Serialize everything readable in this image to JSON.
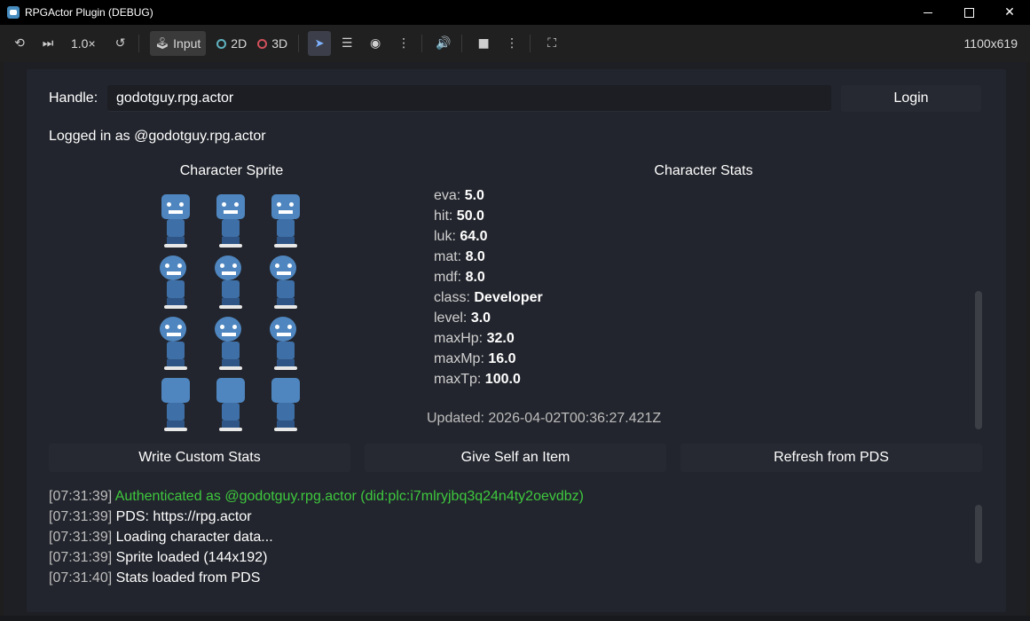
{
  "window": {
    "title": "RPGActor Plugin (DEBUG)"
  },
  "toolbar": {
    "speed": "1.0×",
    "input_label": "Input",
    "mode_2d": "2D",
    "mode_3d": "3D",
    "resolution": "1100x619"
  },
  "handle": {
    "label": "Handle:",
    "value": "godotguy.rpg.actor",
    "login_label": "Login"
  },
  "status": "Logged in as @godotguy.rpg.actor",
  "sprite_title": "Character Sprite",
  "stats_title": "Character Stats",
  "stats": [
    {
      "key": "eva:",
      "value": "5.0"
    },
    {
      "key": "hit:",
      "value": "50.0"
    },
    {
      "key": "luk:",
      "value": "64.0"
    },
    {
      "key": "mat:",
      "value": "8.0"
    },
    {
      "key": "mdf:",
      "value": "8.0"
    },
    {
      "key": "class:",
      "value": "Developer"
    },
    {
      "key": "level:",
      "value": "3.0"
    },
    {
      "key": "maxHp:",
      "value": "32.0"
    },
    {
      "key": "maxMp:",
      "value": "16.0"
    },
    {
      "key": "maxTp:",
      "value": "100.0"
    }
  ],
  "updated": "Updated: 2026-04-02T00:36:27.421Z",
  "actions": {
    "write_stats": "Write Custom Stats",
    "give_item": "Give Self an Item",
    "refresh": "Refresh from PDS"
  },
  "log": [
    {
      "time": "[07:31:39]",
      "msg": "Authenticated as @godotguy.rpg.actor (did:plc:i7mlryjbq3q24n4ty2oevdbz)"
    },
    {
      "time": "[07:31:39]",
      "msg": "PDS: https://rpg.actor"
    },
    {
      "time": "[07:31:39]",
      "msg": "Loading character data..."
    },
    {
      "time": "[07:31:39]",
      "msg": "Sprite loaded (144x192)"
    },
    {
      "time": "[07:31:40]",
      "msg": "Stats loaded from PDS"
    }
  ],
  "colors": {
    "success": "#3ec83e",
    "accent": "#478cbf"
  }
}
